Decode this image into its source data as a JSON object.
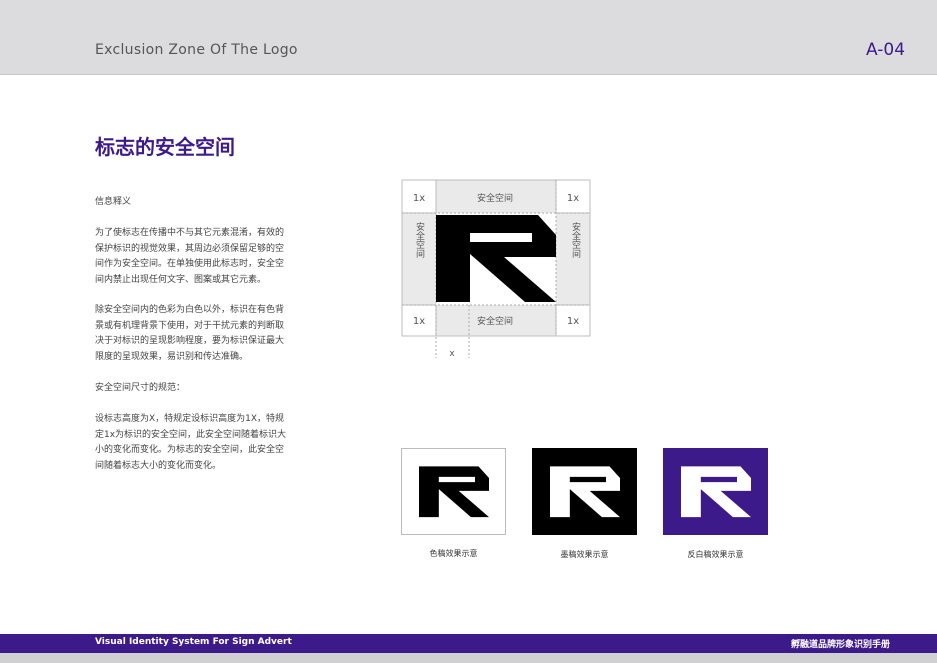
{
  "header": {
    "title": "Exclusion Zone Of The Logo",
    "page_code": "A-04"
  },
  "section_title": "标志的安全空间",
  "body": {
    "info_heading": "信息释义",
    "para1_lines": [
      "为了使标志在传播中不与其它元素混淆，有效的",
      "保护标识的视觉效果，其周边必须保留足够的空",
      "间作为安全空间。在单独使用此标志时，安全空",
      "间内禁止出现任何文字、图案或其它元素。"
    ],
    "para2_lines": [
      "除安全空间内的色彩为白色以外，标识在有色背",
      "景或有机理背景下使用，对于干扰元素的判断取",
      "决于对标识的呈现影响程度，要为标识保证最大",
      "限度的呈现效果，易识别和传达准确。"
    ],
    "size_heading": "安全空间尺寸的规范：",
    "para3_lines": [
      "设标志高度为X，特规定设标识高度为1X，特规",
      "定1x为标识的安全空间，此安全空间随着标识大",
      "小的变化而变化。为标志的安全空间，此安全空",
      "间随着标志大小的变化而变化。"
    ]
  },
  "diagram": {
    "corner_label": "1x",
    "top_label": "安全空间",
    "bottom_label": "安全空间",
    "side_label": "安全空间",
    "x_label": "x"
  },
  "samples": [
    {
      "caption": "色稿效果示意",
      "bg": "#ffffff",
      "logo": "#000000"
    },
    {
      "caption": "墨稿效果示意",
      "bg": "#000000",
      "logo": "#ffffff"
    },
    {
      "caption": "反白稿效果示意",
      "bg": "#3d1a8a",
      "logo": "#ffffff"
    }
  ],
  "footer": {
    "left": "Visual Identity System For Sign Advert",
    "right": "孵融道品牌形象识别手册"
  },
  "colors": {
    "brand": "#3d1a8a",
    "header_bg": "#dcdcde",
    "zone_bg": "#eaeaea"
  }
}
